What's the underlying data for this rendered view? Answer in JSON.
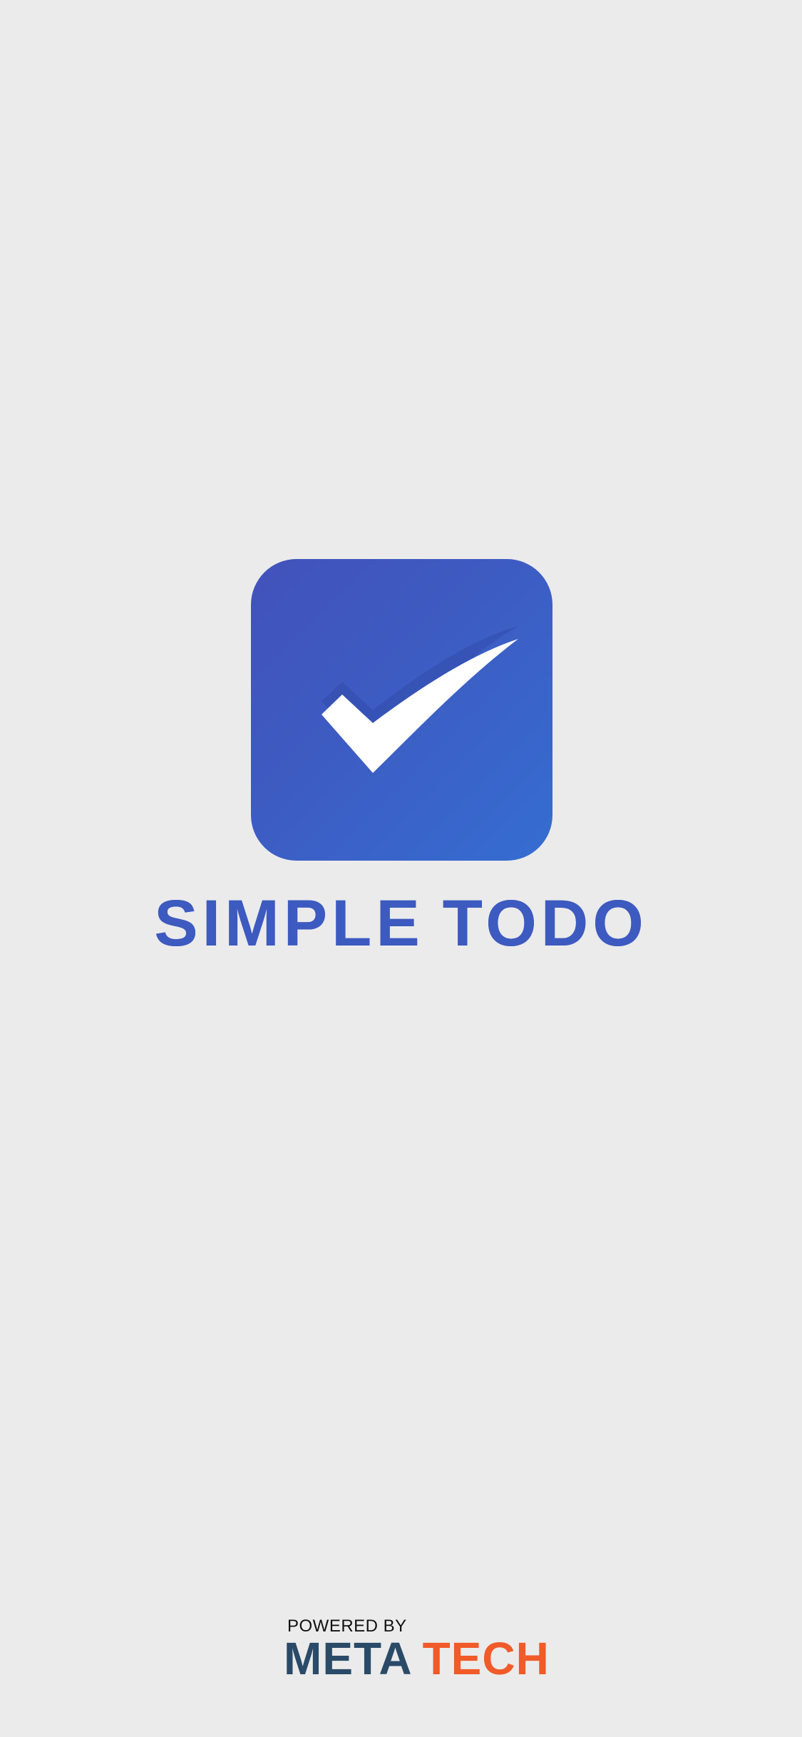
{
  "app": {
    "title_part1": "SIMPLE",
    "title_part2": "TODO",
    "icon": "checkbox-checked-icon"
  },
  "footer": {
    "powered_by": "POWERED BY",
    "brand_part1": "META",
    "brand_part2": "TECH"
  },
  "colors": {
    "background": "#ebebeb",
    "accent": "#3d5ac0",
    "brand_dark": "#2a4a68",
    "brand_orange": "#f15a29"
  }
}
